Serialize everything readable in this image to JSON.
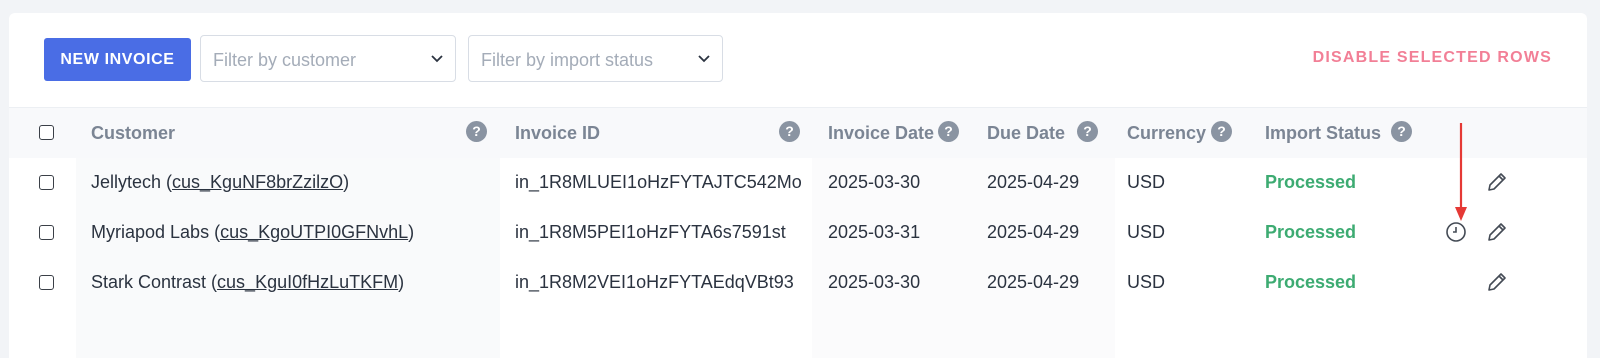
{
  "toolbar": {
    "new_invoice_label": "NEW INVOICE",
    "customer_filter_placeholder": "Filter by customer",
    "import_status_filter_placeholder": "Filter by import status",
    "disable_rows_label": "DISABLE SELECTED ROWS"
  },
  "table": {
    "columns": [
      "Customer",
      "Invoice ID",
      "Invoice Date",
      "Due Date",
      "Currency",
      "Import Status"
    ],
    "help_glyph": "?",
    "rows": [
      {
        "customer_name": "Jellytech (",
        "customer_id": "cus_KguNF8brZzilzO",
        "customer_close": ")",
        "invoice_id": "in_1R8MLUEI1oHzFYTAJTC542Mo",
        "invoice_date": "2025-03-30",
        "due_date": "2025-04-29",
        "currency": "USD",
        "import_status": "Processed"
      },
      {
        "customer_name": "Myriapod Labs (",
        "customer_id": "cus_KgoUTPI0GFNvhL",
        "customer_close": ")",
        "invoice_id": "in_1R8M5PEI1oHzFYTA6s7591st",
        "invoice_date": "2025-03-31",
        "due_date": "2025-04-29",
        "currency": "USD",
        "import_status": "Processed"
      },
      {
        "customer_name": "Stark Contrast (",
        "customer_id": "cus_KguI0fHzLuTKFM",
        "customer_close": ")",
        "invoice_id": "in_1R8M2VEI1oHzFYTAEdqVBt93",
        "invoice_date": "2025-03-30",
        "due_date": "2025-04-29",
        "currency": "USD",
        "import_status": "Processed"
      }
    ]
  },
  "icons": {
    "edit": "pencil-icon",
    "history": "clock-icon",
    "help": "question-icon",
    "annotation": "arrow-down-icon"
  },
  "colors": {
    "primary": "#4a6de5",
    "danger_text": "#f27f96",
    "status_processed": "#3dab72",
    "annotation_arrow": "#e53935"
  }
}
